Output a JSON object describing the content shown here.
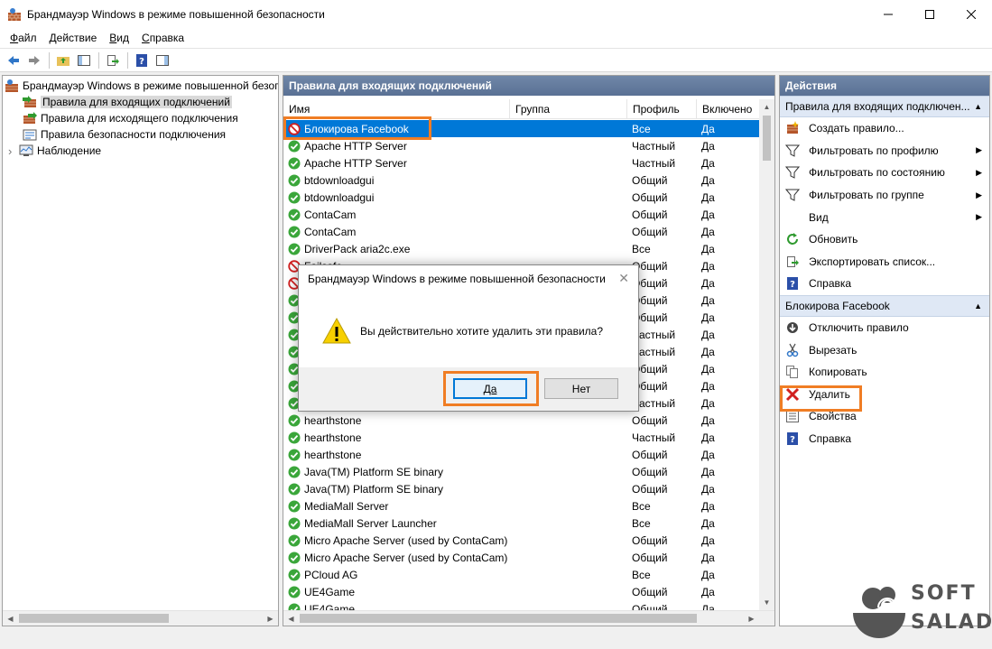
{
  "window": {
    "title": "Брандмауэр Windows в режиме повышенной безопасности",
    "minimize": "—",
    "maximize": "☐",
    "close": "✕"
  },
  "menu": {
    "items": [
      {
        "u": "Ф",
        "rest": "айл"
      },
      {
        "u": "Д",
        "rest": "ействие"
      },
      {
        "u": "В",
        "rest": "ид"
      },
      {
        "u": "С",
        "rest": "правка"
      }
    ]
  },
  "tree": {
    "root": "Брандмауэр Windows в режиме повышенной безопасности",
    "items": [
      "Правила для входящих подключений",
      "Правила для исходящего подключения",
      "Правила безопасности подключения",
      "Наблюдение"
    ],
    "expander": "›"
  },
  "center": {
    "header": "Правила для входящих подключений",
    "columns": [
      "Имя",
      "Группа",
      "Профиль",
      "Включено"
    ],
    "rows": [
      {
        "name": "Блокирова Facebook",
        "group": "",
        "profile": "Все",
        "enabled": "Да",
        "icon": "block",
        "selected": true
      },
      {
        "name": "Apache HTTP Server",
        "group": "",
        "profile": "Частный",
        "enabled": "Да",
        "icon": "allow"
      },
      {
        "name": "Apache HTTP Server",
        "group": "",
        "profile": "Частный",
        "enabled": "Да",
        "icon": "allow"
      },
      {
        "name": "btdownloadgui",
        "group": "",
        "profile": "Общий",
        "enabled": "Да",
        "icon": "allow"
      },
      {
        "name": "btdownloadgui",
        "group": "",
        "profile": "Общий",
        "enabled": "Да",
        "icon": "allow"
      },
      {
        "name": "ContaCam",
        "group": "",
        "profile": "Общий",
        "enabled": "Да",
        "icon": "allow"
      },
      {
        "name": "ContaCam",
        "group": "",
        "profile": "Общий",
        "enabled": "Да",
        "icon": "allow"
      },
      {
        "name": "DriverPack aria2c.exe",
        "group": "",
        "profile": "Все",
        "enabled": "Да",
        "icon": "allow"
      },
      {
        "name": "Failsafe",
        "group": "",
        "profile": "Общий",
        "enabled": "Да",
        "icon": "block"
      },
      {
        "name": "",
        "group": "",
        "profile": "Общий",
        "enabled": "Да",
        "icon": "block"
      },
      {
        "name": "",
        "group": "",
        "profile": "Общий",
        "enabled": "Да",
        "icon": "allow"
      },
      {
        "name": "",
        "group": "",
        "profile": "Общий",
        "enabled": "Да",
        "icon": "allow"
      },
      {
        "name": "",
        "group": "",
        "profile": "Частный",
        "enabled": "Да",
        "icon": "allow"
      },
      {
        "name": "",
        "group": "",
        "profile": "Частный",
        "enabled": "Да",
        "icon": "allow"
      },
      {
        "name": "",
        "group": "",
        "profile": "Общий",
        "enabled": "Да",
        "icon": "allow"
      },
      {
        "name": "",
        "group": "",
        "profile": "Общий",
        "enabled": "Да",
        "icon": "allow"
      },
      {
        "name": "",
        "group": "",
        "profile": "Частный",
        "enabled": "Да",
        "icon": "allow"
      },
      {
        "name": "hearthstone",
        "group": "",
        "profile": "Общий",
        "enabled": "Да",
        "icon": "allow"
      },
      {
        "name": "hearthstone",
        "group": "",
        "profile": "Частный",
        "enabled": "Да",
        "icon": "allow"
      },
      {
        "name": "hearthstone",
        "group": "",
        "profile": "Общий",
        "enabled": "Да",
        "icon": "allow"
      },
      {
        "name": "Java(TM) Platform SE binary",
        "group": "",
        "profile": "Общий",
        "enabled": "Да",
        "icon": "allow"
      },
      {
        "name": "Java(TM) Platform SE binary",
        "group": "",
        "profile": "Общий",
        "enabled": "Да",
        "icon": "allow"
      },
      {
        "name": "MediaMall Server",
        "group": "",
        "profile": "Все",
        "enabled": "Да",
        "icon": "allow"
      },
      {
        "name": "MediaMall Server Launcher",
        "group": "",
        "profile": "Все",
        "enabled": "Да",
        "icon": "allow"
      },
      {
        "name": "Micro Apache Server (used by ContaCam)",
        "group": "",
        "profile": "Общий",
        "enabled": "Да",
        "icon": "allow"
      },
      {
        "name": "Micro Apache Server (used by ContaCam)",
        "group": "",
        "profile": "Общий",
        "enabled": "Да",
        "icon": "allow"
      },
      {
        "name": "PCloud AG",
        "group": "",
        "profile": "Все",
        "enabled": "Да",
        "icon": "allow"
      },
      {
        "name": "UE4Game",
        "group": "",
        "profile": "Общий",
        "enabled": "Да",
        "icon": "allow"
      },
      {
        "name": "UE4Game",
        "group": "",
        "profile": "Общий",
        "enabled": "Да",
        "icon": "allow"
      }
    ]
  },
  "actions": {
    "header": "Действия",
    "section1": {
      "title": "Правила для входящих подключен...",
      "items": [
        {
          "label": "Создать правило...",
          "icon": "new-rule-icon",
          "sub": false
        },
        {
          "label": "Фильтровать по профилю",
          "icon": "filter-icon",
          "sub": true
        },
        {
          "label": "Фильтровать по состоянию",
          "icon": "filter-icon",
          "sub": true
        },
        {
          "label": "Фильтровать по группе",
          "icon": "filter-icon",
          "sub": true
        },
        {
          "label": "Вид",
          "icon": "",
          "sub": true
        },
        {
          "label": "Обновить",
          "icon": "refresh-icon",
          "sub": false
        },
        {
          "label": "Экспортировать список...",
          "icon": "export-icon",
          "sub": false
        },
        {
          "label": "Справка",
          "icon": "help-icon",
          "sub": false
        }
      ]
    },
    "section2": {
      "title": "Блокирова Facebook",
      "items": [
        {
          "label": "Отключить правило",
          "icon": "disable-icon"
        },
        {
          "label": "Вырезать",
          "icon": "cut-icon"
        },
        {
          "label": "Копировать",
          "icon": "copy-icon"
        },
        {
          "label": "Удалить",
          "icon": "delete-icon"
        },
        {
          "label": "Свойства",
          "icon": "properties-icon"
        },
        {
          "label": "Справка",
          "icon": "help-icon"
        }
      ]
    },
    "collapse": "▲",
    "submenu_arrow": "▶"
  },
  "dialog": {
    "title": "Брандмауэр Windows в режиме повышенной безопасности",
    "close": "✕",
    "message": "Вы действительно хотите удалить эти правила?",
    "yes": "Да",
    "no": "Нет"
  },
  "watermark": {
    "line1": "SOFT",
    "line2": "SALAD"
  },
  "colors": {
    "accent": "#0078d7",
    "highlight": "#f07d24",
    "pane_header": "#5f7699",
    "allow": "#3aa63a",
    "block": "#d12020"
  }
}
